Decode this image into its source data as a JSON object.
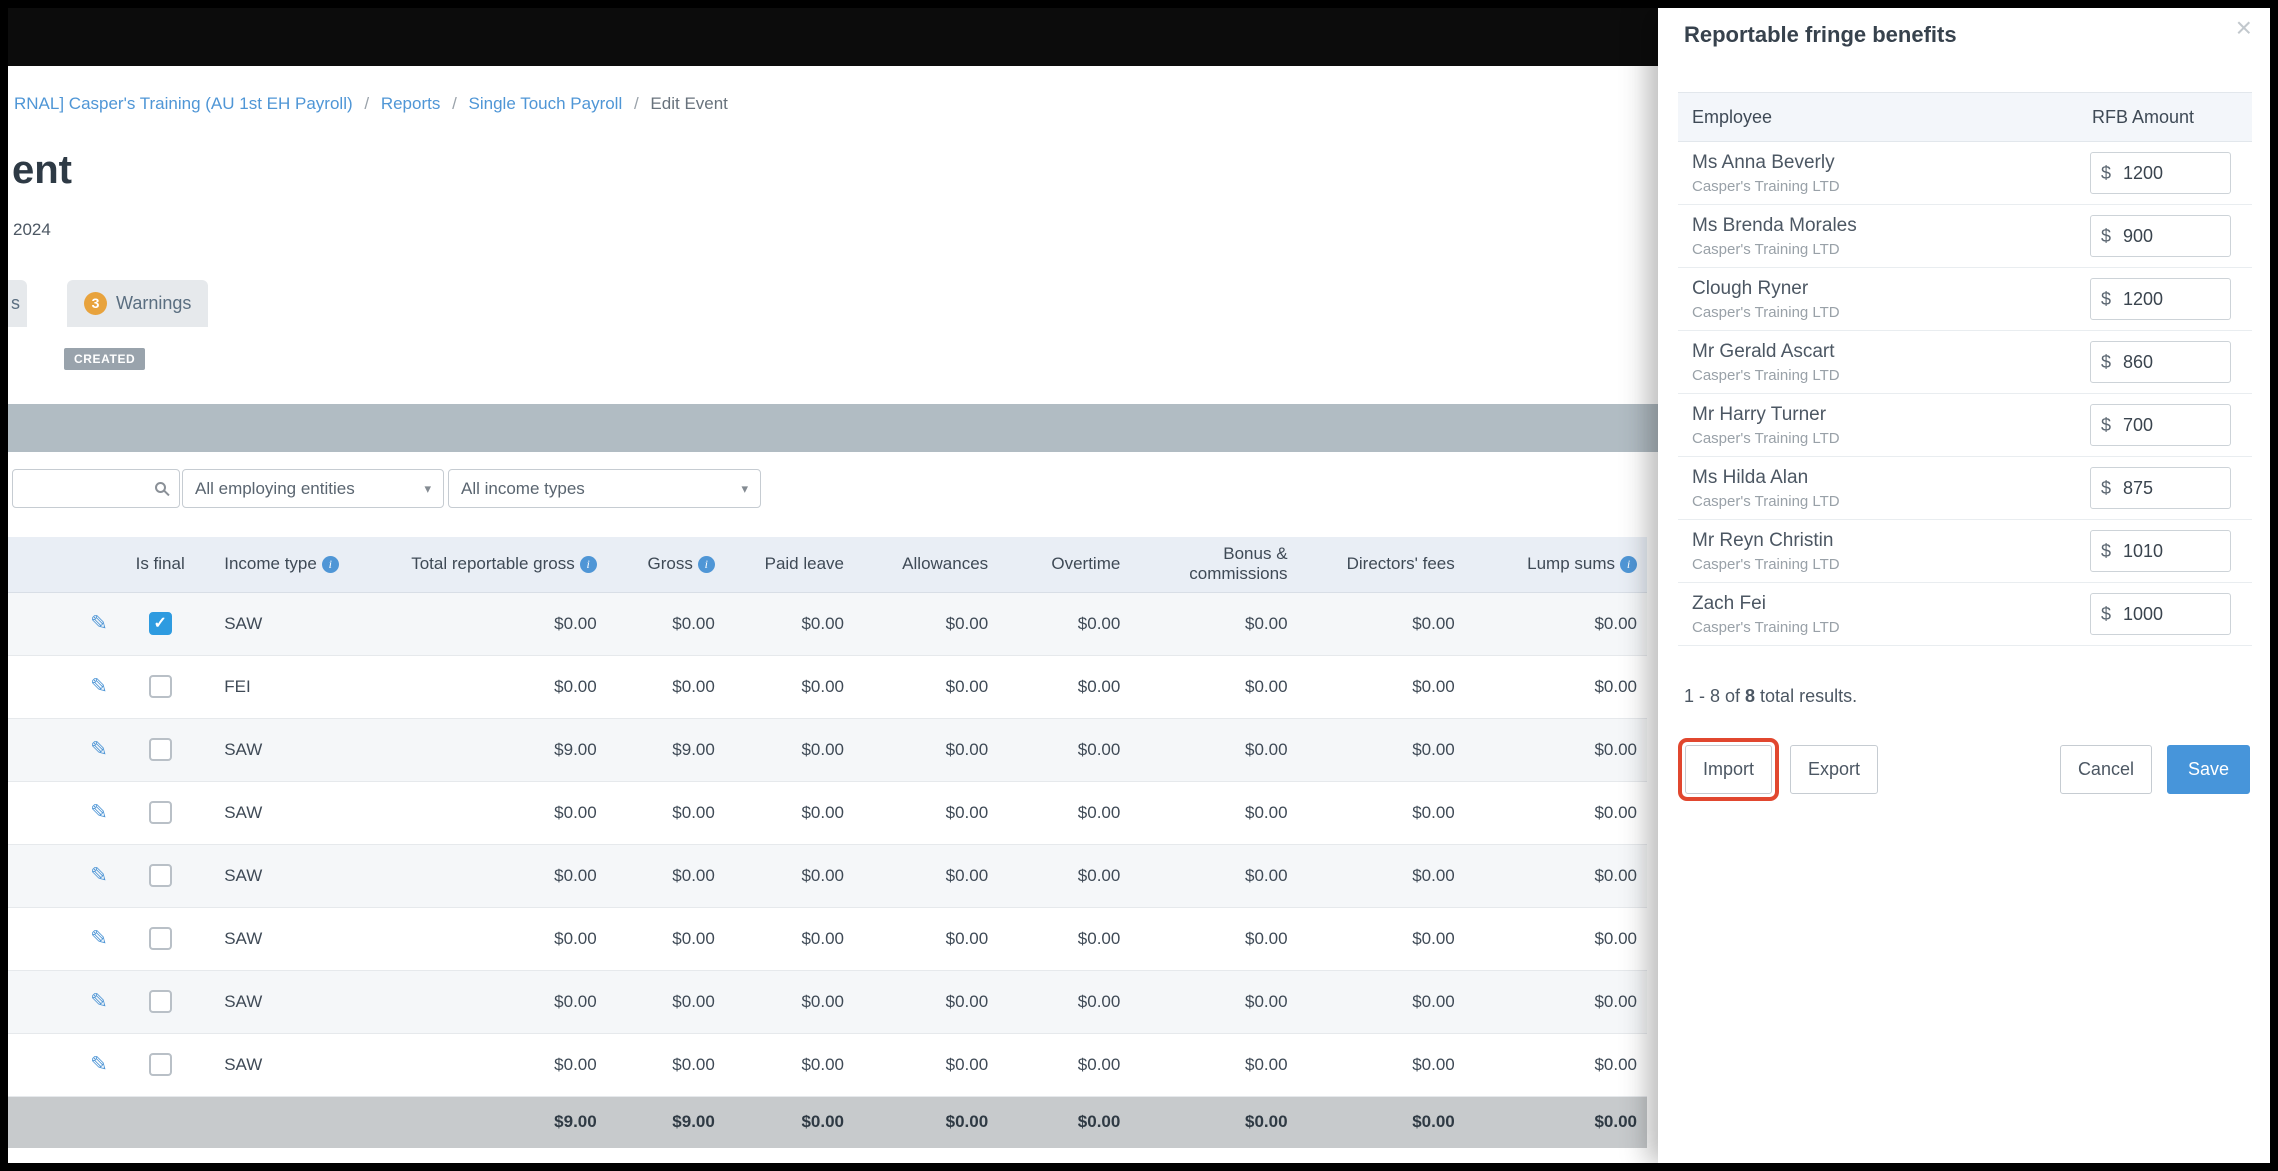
{
  "breadcrumb": {
    "separator": "/",
    "items": [
      {
        "label": "RNAL] Casper's Training (AU 1st EH Payroll)",
        "type": "link"
      },
      {
        "label": "Reports",
        "type": "link"
      },
      {
        "label": "Single Touch Payroll",
        "type": "link"
      },
      {
        "label": "Edit Event",
        "type": "current"
      }
    ]
  },
  "page": {
    "title_fragment": "ent",
    "subtitle_fragment": "2024",
    "status_badge": "CREATED",
    "tabs": {
      "fragment_label": "s",
      "warnings": {
        "count": "3",
        "label": "Warnings"
      }
    }
  },
  "filters": {
    "search_value": "",
    "entities_dropdown": "All employing entities",
    "income_dropdown": "All income types"
  },
  "stp_table": {
    "columns": [
      {
        "label": "",
        "align": "center",
        "name": "employee"
      },
      {
        "label": "",
        "align": "center",
        "name": "edit"
      },
      {
        "label": "Is final",
        "align": "center",
        "name": "is-final"
      },
      {
        "label": "Income type",
        "align": "left",
        "info": true,
        "name": "income-type"
      },
      {
        "label": "Total reportable gross",
        "align": "right",
        "info": true,
        "name": "total-reportable-gross"
      },
      {
        "label": "Gross",
        "align": "right",
        "info": true,
        "name": "gross"
      },
      {
        "label": "Paid leave",
        "align": "right",
        "name": "paid-leave"
      },
      {
        "label": "Allowances",
        "align": "right",
        "name": "allowances"
      },
      {
        "label": "Overtime",
        "align": "right",
        "name": "overtime"
      },
      {
        "label": "Bonus & commissions",
        "align": "right",
        "name": "bonus-commissions"
      },
      {
        "label": "Directors' fees",
        "align": "right",
        "name": "directors-fees"
      },
      {
        "label": "Lump sums",
        "align": "right",
        "info": true,
        "name": "lump-sums"
      }
    ],
    "rows": [
      {
        "income_type": "SAW",
        "is_final": true,
        "values": [
          "$0.00",
          "$0.00",
          "$0.00",
          "$0.00",
          "$0.00",
          "$0.00",
          "$0.00",
          "$0.00"
        ]
      },
      {
        "income_type": "FEI",
        "is_final": false,
        "values": [
          "$0.00",
          "$0.00",
          "$0.00",
          "$0.00",
          "$0.00",
          "$0.00",
          "$0.00",
          "$0.00"
        ]
      },
      {
        "income_type": "SAW",
        "is_final": false,
        "values": [
          "$9.00",
          "$9.00",
          "$0.00",
          "$0.00",
          "$0.00",
          "$0.00",
          "$0.00",
          "$0.00"
        ]
      },
      {
        "income_type": "SAW",
        "is_final": false,
        "values": [
          "$0.00",
          "$0.00",
          "$0.00",
          "$0.00",
          "$0.00",
          "$0.00",
          "$0.00",
          "$0.00"
        ]
      },
      {
        "income_type": "SAW",
        "is_final": false,
        "values": [
          "$0.00",
          "$0.00",
          "$0.00",
          "$0.00",
          "$0.00",
          "$0.00",
          "$0.00",
          "$0.00"
        ]
      },
      {
        "income_type": "SAW",
        "is_final": false,
        "values": [
          "$0.00",
          "$0.00",
          "$0.00",
          "$0.00",
          "$0.00",
          "$0.00",
          "$0.00",
          "$0.00"
        ]
      },
      {
        "income_type": "SAW",
        "is_final": false,
        "values": [
          "$0.00",
          "$0.00",
          "$0.00",
          "$0.00",
          "$0.00",
          "$0.00",
          "$0.00",
          "$0.00"
        ]
      },
      {
        "income_type": "SAW",
        "is_final": false,
        "values": [
          "$0.00",
          "$0.00",
          "$0.00",
          "$0.00",
          "$0.00",
          "$0.00",
          "$0.00",
          "$0.00"
        ]
      }
    ],
    "totals": [
      "$9.00",
      "$9.00",
      "$0.00",
      "$0.00",
      "$0.00",
      "$0.00",
      "$0.00",
      "$0.00"
    ]
  },
  "rfb_panel": {
    "title": "Reportable fringe benefits",
    "columns": {
      "employee": "Employee",
      "amount": "RFB Amount"
    },
    "currency": "$",
    "rows": [
      {
        "name": "Ms Anna Beverly",
        "company": "Casper's Training LTD",
        "amount": "1200"
      },
      {
        "name": "Ms Brenda Morales",
        "company": "Casper's Training LTD",
        "amount": "900"
      },
      {
        "name": "Clough Ryner",
        "company": "Casper's Training LTD",
        "amount": "1200"
      },
      {
        "name": "Mr Gerald Ascart",
        "company": "Casper's Training LTD",
        "amount": "860"
      },
      {
        "name": "Mr Harry Turner",
        "company": "Casper's Training LTD",
        "amount": "700"
      },
      {
        "name": "Ms Hilda Alan",
        "company": "Casper's Training LTD",
        "amount": "875"
      },
      {
        "name": "Mr Reyn Christin",
        "company": "Casper's Training LTD",
        "amount": "1010"
      },
      {
        "name": "Zach Fei",
        "company": "Casper's Training LTD",
        "amount": "1000"
      }
    ],
    "results": {
      "prefix": "1 - 8 of ",
      "bold": "8",
      "suffix": " total results."
    },
    "buttons": {
      "import": "Import",
      "export": "Export",
      "cancel": "Cancel",
      "save": "Save"
    }
  },
  "icons": {
    "close": "×",
    "pencil": "✎",
    "check": "✓",
    "caret": "▾",
    "info": "i"
  },
  "colors": {
    "link_blue": "#4f96d6",
    "warning_orange": "#e8a33d",
    "save_blue": "#4795da",
    "annotation_red": "#e1472f",
    "banner_gray": "#b1bcc3",
    "table_header_bg": "#e9eef5",
    "totals_bg": "#c7cacc",
    "status_badge_gray": "#99a3ac",
    "checkbox_checked": "#2e9be0"
  }
}
